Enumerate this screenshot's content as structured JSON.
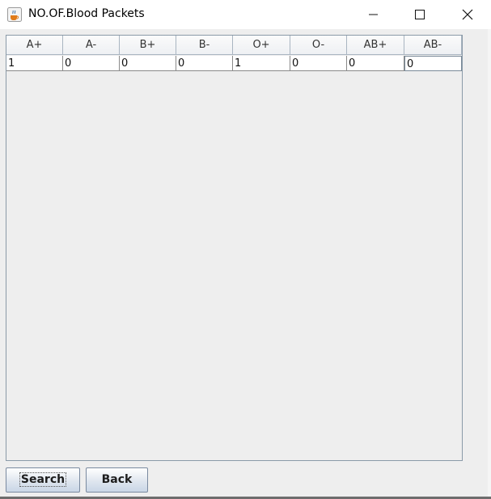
{
  "window": {
    "title": "NO.OF.Blood Packets",
    "app_icon": "java-coffee-icon",
    "controls": [
      "minimize-icon",
      "maximize-icon",
      "close-icon"
    ]
  },
  "table": {
    "columns": [
      "A+",
      "A-",
      "B+",
      "B-",
      "O+",
      "O-",
      "AB+",
      "AB-"
    ],
    "rows": [
      [
        "1",
        "0",
        "0",
        "0",
        "1",
        "0",
        "0",
        "0"
      ]
    ]
  },
  "buttons": {
    "search_label": "Search",
    "back_label": "Back"
  }
}
